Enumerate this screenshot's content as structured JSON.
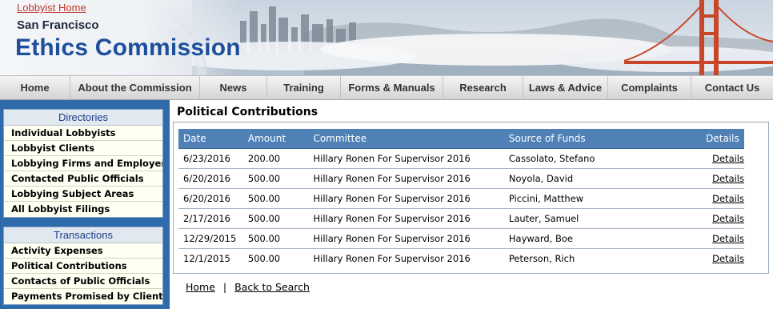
{
  "header": {
    "lobbyist_home": "Lobbyist Home",
    "brand_sub": "San Francisco",
    "brand_main": "Ethics Commission"
  },
  "nav": {
    "items": [
      {
        "label": "Home"
      },
      {
        "label": "About the Commission"
      },
      {
        "label": "News"
      },
      {
        "label": "Training"
      },
      {
        "label": "Forms & Manuals"
      },
      {
        "label": "Research"
      },
      {
        "label": "Laws & Advice"
      },
      {
        "label": "Complaints"
      },
      {
        "label": "Contact Us"
      }
    ]
  },
  "sidebar": {
    "directories": {
      "title": "Directories",
      "items": [
        {
          "label": "Individual Lobbyists"
        },
        {
          "label": "Lobbyist Clients"
        },
        {
          "label": "Lobbying Firms and Employers"
        },
        {
          "label": "Contacted Public Officials"
        },
        {
          "label": "Lobbying Subject Areas"
        },
        {
          "label": "All Lobbyist Filings"
        }
      ]
    },
    "transactions": {
      "title": "Transactions",
      "items": [
        {
          "label": "Activity Expenses"
        },
        {
          "label": "Political Contributions"
        },
        {
          "label": "Contacts of Public Officials"
        },
        {
          "label": "Payments Promised by Clients"
        }
      ]
    }
  },
  "main": {
    "title": "Political Contributions",
    "table": {
      "headers": [
        "Date",
        "Amount",
        "Committee",
        "Source of Funds",
        "Details"
      ],
      "rows": [
        {
          "date": "6/23/2016",
          "amount": "200.00",
          "committee": "Hillary Ronen For Supervisor 2016",
          "source": "Cassolato, Stefano",
          "details": "Details"
        },
        {
          "date": "6/20/2016",
          "amount": "500.00",
          "committee": "Hillary Ronen For Supervisor 2016",
          "source": "Noyola, David",
          "details": "Details"
        },
        {
          "date": "6/20/2016",
          "amount": "500.00",
          "committee": "Hillary Ronen For Supervisor 2016",
          "source": "Piccini, Matthew",
          "details": "Details"
        },
        {
          "date": "2/17/2016",
          "amount": "500.00",
          "committee": "Hillary Ronen For Supervisor 2016",
          "source": "Lauter, Samuel",
          "details": "Details"
        },
        {
          "date": "12/29/2015",
          "amount": "500.00",
          "committee": "Hillary Ronen For Supervisor 2016",
          "source": "Hayward, Boe",
          "details": "Details"
        },
        {
          "date": "12/1/2015",
          "amount": "500.00",
          "committee": "Hillary Ronen For Supervisor 2016",
          "source": "Peterson, Rich",
          "details": "Details"
        }
      ]
    },
    "footer_links": {
      "home": "Home",
      "separator": "|",
      "back": "Back to Search"
    }
  },
  "colors": {
    "brand_blue": "#1d4f9c",
    "sidebar_blue": "#2f6aab",
    "table_header": "#4f81b7",
    "link_red": "#c0392b"
  }
}
